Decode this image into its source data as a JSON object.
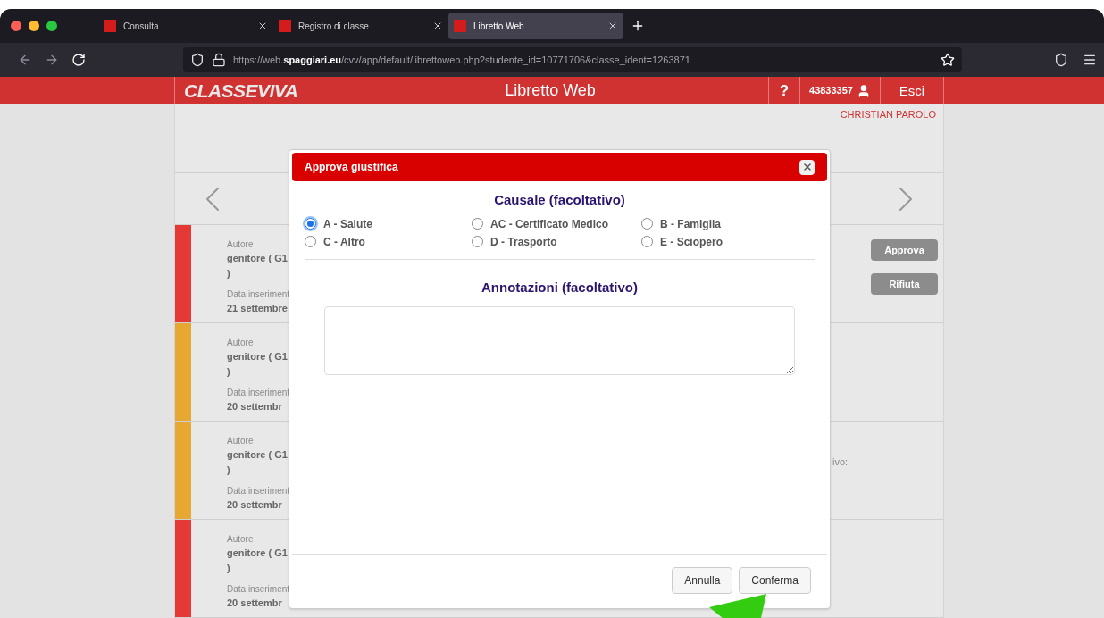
{
  "browser": {
    "tabs": [
      {
        "title": "Consulta",
        "selected": false
      },
      {
        "title": "Registro di classe",
        "selected": false
      },
      {
        "title": "Libretto Web",
        "selected": true
      }
    ],
    "url": "https://web.**spaggiari.eu**/cvv/app/default/librettoweb.php?studente_id=10771706&classe_ident=1263871"
  },
  "header": {
    "logo": "CLASSEVIVA",
    "title": "Libretto Web",
    "help": "?",
    "user_code": "43833357",
    "logout": "Esci",
    "user_name": "CHRISTIAN PAROLO"
  },
  "entries": [
    {
      "color": "#e53935",
      "author_label": "Autore",
      "author": "genitore ( G1",
      "author_end": ")",
      "date_label": "Data inseriment",
      "date": "21 settembre",
      "kind": "actions",
      "actions": [
        "Approva",
        "Rifiuta"
      ]
    },
    {
      "color": "#e6a832",
      "author_label": "Autore",
      "author": "genitore ( G1",
      "author_end": ")",
      "date_label": "Data inseriment",
      "date": "20 settembr",
      "kind": "plain"
    },
    {
      "color": "#e6a832",
      "author_label": "Autore",
      "author": "genitore ( G1",
      "author_end": ")",
      "date_label": "Data inseriment",
      "date": "20 settembr",
      "kind": "note",
      "note": "ivo:"
    },
    {
      "color": "#e53935",
      "author_label": "Autore",
      "author": "genitore ( G1",
      "author_end": ")",
      "date_label": "Data inseriment",
      "date": "20 settembr",
      "kind": "plain"
    }
  ],
  "dialog": {
    "title": "Approva giustifica",
    "causale_title": "Causale (facoltativo)",
    "reasons": [
      {
        "label": "A - Salute",
        "selected": true
      },
      {
        "label": "AC - Certificato Medico",
        "selected": false
      },
      {
        "label": "B - Famiglia",
        "selected": false
      },
      {
        "label": "C - Altro",
        "selected": false
      },
      {
        "label": "D - Trasporto",
        "selected": false
      },
      {
        "label": "E - Sciopero",
        "selected": false
      }
    ],
    "annotations_title": "Annotazioni (facoltativo)",
    "buttons": [
      "Annulla",
      "Conferma"
    ]
  }
}
